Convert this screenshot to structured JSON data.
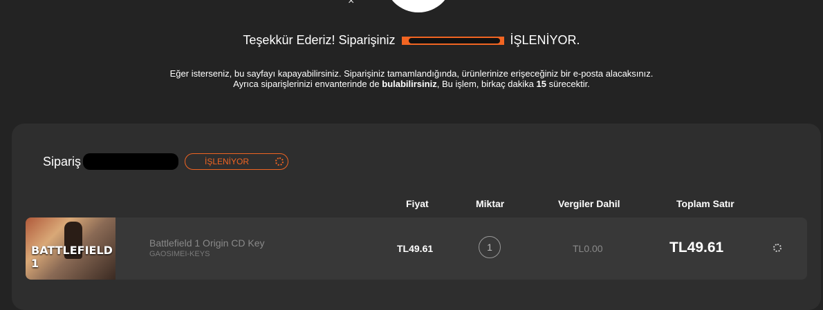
{
  "header": {
    "headline_prefix": "Teşekkür Ederiz! Siparişiniz",
    "headline_suffix": "İŞLENİYOR.",
    "subtext_line1": "Eğer isterseniz, bu sayfayı kapayabilirsiniz. Siparişiniz tamamlandığında, ürünlerinize erişeceğiniz bir e-posta alacaksınız.",
    "subtext_line2_part1": "Ayrıca siparişlerinizi envanterinde de",
    "subtext_line2_bold1": "bulabilirsiniz",
    "subtext_line2_part2": ", Bu işlem, birkaç dakika",
    "subtext_line2_bold2": "15",
    "subtext_line2_part3": "sürecektir.",
    "close_symbol": "×",
    "accent_color": "#f26522"
  },
  "order": {
    "label": "Sipariş",
    "status": "İŞLENİYOR",
    "columns": {
      "price": "Fiyat",
      "quantity": "Miktar",
      "tax": "Vergiler Dahil",
      "total": "Toplam Satır"
    },
    "items": [
      {
        "thumbnail_text": "BATTLEFIELD 1",
        "name": "Battlefield 1 Origin CD Key",
        "seller": "GAOSIMEI-KEYS",
        "price": "TL49.61",
        "quantity": "1",
        "tax": "TL0.00",
        "total": "TL49.61",
        "status_icon": "loading-spinner-icon"
      }
    ]
  }
}
